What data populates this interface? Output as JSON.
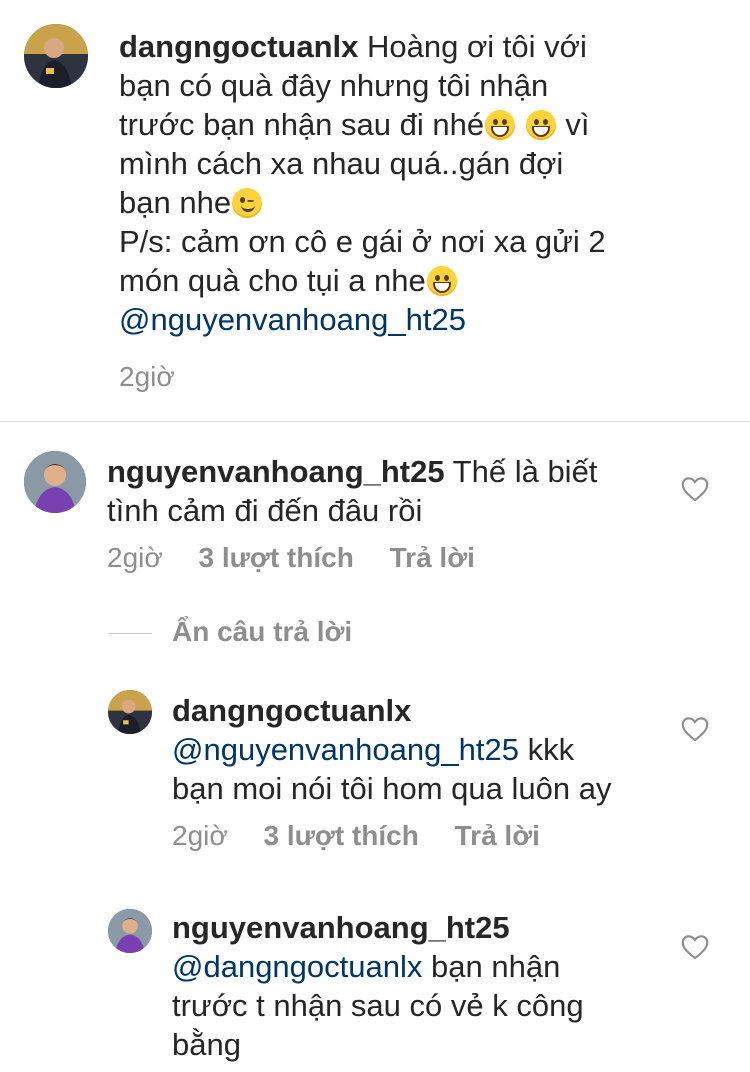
{
  "comments": [
    {
      "username": "dangngoctuanlx",
      "segments": [
        "Hoàng ơi tôi với",
        "bạn có quà đây nhưng tôi nhận",
        "trước bạn nhận sau đi nhé",
        "vì",
        "mình cách xa nhau quá..gán đợi",
        "bạn nhe",
        "P/s: cảm ơn cô e gái ở nơi xa gửi 2",
        "món quà cho tụi a nhe"
      ],
      "mention": "@nguyenvanhoang_ht25",
      "time": "2giờ"
    },
    {
      "username": "nguyenvanhoang_ht25",
      "segments": [
        "Thế là biết",
        "tình cảm đi đến đâu rồi"
      ],
      "time": "2giờ",
      "likes": "3 lượt thích",
      "reply": "Trả lời"
    }
  ],
  "hide_replies": "Ẩn câu trả lời",
  "replies": [
    {
      "username": "dangngoctuanlx",
      "mention": "@nguyenvanhoang_ht25",
      "segments": [
        "kkk",
        "bạn moi nói tôi hom qua luôn ay"
      ],
      "time": "2giờ",
      "likes": "3 lượt thích",
      "reply": "Trả lời"
    },
    {
      "username": "nguyenvanhoang_ht25",
      "mention": "@dangngoctuanlx",
      "segments": [
        "bạn nhận",
        "trước t nhận sau có vẻ k công",
        "bằng"
      ]
    }
  ],
  "colors": {
    "mention": "#003569",
    "meta": "#8e8e8e",
    "text": "#262626",
    "divider": "#dbdbdb"
  },
  "icons": [
    "heart-icon",
    "avatar"
  ]
}
